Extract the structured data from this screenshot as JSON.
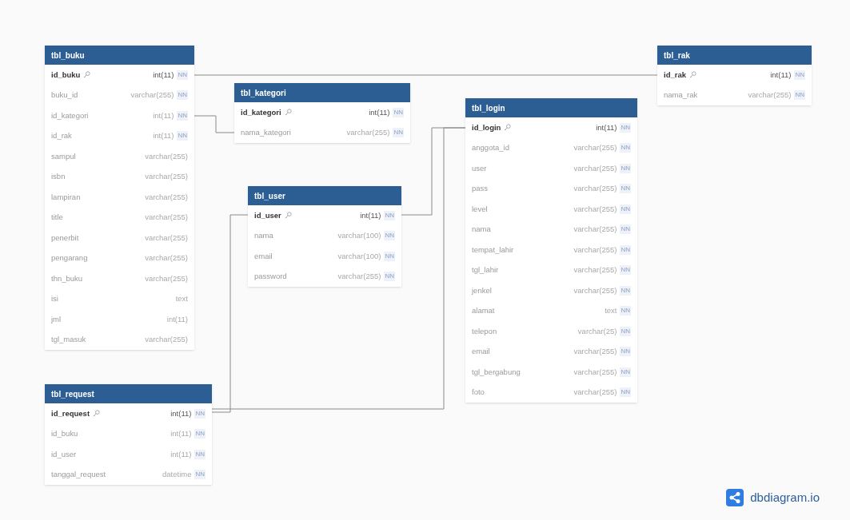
{
  "tables": [
    {
      "name": "tbl_buku",
      "columns": [
        {
          "name": "id_buku",
          "type": "int(11)",
          "constraint": "NN",
          "primary_key": true
        },
        {
          "name": "buku_id",
          "type": "varchar(255)",
          "constraint": "NN",
          "primary_key": false
        },
        {
          "name": "id_kategori",
          "type": "int(11)",
          "constraint": "NN",
          "primary_key": false
        },
        {
          "name": "id_rak",
          "type": "int(11)",
          "constraint": "NN",
          "primary_key": false
        },
        {
          "name": "sampul",
          "type": "varchar(255)",
          "primary_key": false
        },
        {
          "name": "isbn",
          "type": "varchar(255)",
          "primary_key": false
        },
        {
          "name": "lampiran",
          "type": "varchar(255)",
          "primary_key": false
        },
        {
          "name": "title",
          "type": "varchar(255)",
          "primary_key": false
        },
        {
          "name": "penerbit",
          "type": "varchar(255)",
          "primary_key": false
        },
        {
          "name": "pengarang",
          "type": "varchar(255)",
          "primary_key": false
        },
        {
          "name": "thn_buku",
          "type": "varchar(255)",
          "primary_key": false
        },
        {
          "name": "isi",
          "type": "text",
          "primary_key": false
        },
        {
          "name": "jml",
          "type": "int(11)",
          "primary_key": false
        },
        {
          "name": "tgl_masuk",
          "type": "varchar(255)",
          "primary_key": false
        }
      ]
    },
    {
      "name": "tbl_kategori",
      "columns": [
        {
          "name": "id_kategori",
          "type": "int(11)",
          "constraint": "NN",
          "primary_key": true
        },
        {
          "name": "nama_kategori",
          "type": "varchar(255)",
          "constraint": "NN",
          "primary_key": false
        }
      ]
    },
    {
      "name": "tbl_user",
      "columns": [
        {
          "name": "id_user",
          "type": "int(11)",
          "constraint": "NN",
          "primary_key": true
        },
        {
          "name": "nama",
          "type": "varchar(100)",
          "constraint": "NN",
          "primary_key": false
        },
        {
          "name": "email",
          "type": "varchar(100)",
          "constraint": "NN",
          "primary_key": false
        },
        {
          "name": "password",
          "type": "varchar(255)",
          "constraint": "NN",
          "primary_key": false
        }
      ]
    },
    {
      "name": "tbl_login",
      "columns": [
        {
          "name": "id_login",
          "type": "int(11)",
          "constraint": "NN",
          "primary_key": true
        },
        {
          "name": "anggota_id",
          "type": "varchar(255)",
          "constraint": "NN",
          "primary_key": false
        },
        {
          "name": "user",
          "type": "varchar(255)",
          "constraint": "NN",
          "primary_key": false
        },
        {
          "name": "pass",
          "type": "varchar(255)",
          "constraint": "NN",
          "primary_key": false
        },
        {
          "name": "level",
          "type": "varchar(255)",
          "constraint": "NN",
          "primary_key": false
        },
        {
          "name": "nama",
          "type": "varchar(255)",
          "constraint": "NN",
          "primary_key": false
        },
        {
          "name": "tempat_lahir",
          "type": "varchar(255)",
          "constraint": "NN",
          "primary_key": false
        },
        {
          "name": "tgl_lahir",
          "type": "varchar(255)",
          "constraint": "NN",
          "primary_key": false
        },
        {
          "name": "jenkel",
          "type": "varchar(255)",
          "constraint": "NN",
          "primary_key": false
        },
        {
          "name": "alamat",
          "type": "text",
          "constraint": "NN",
          "primary_key": false
        },
        {
          "name": "telepon",
          "type": "varchar(25)",
          "constraint": "NN",
          "primary_key": false
        },
        {
          "name": "email",
          "type": "varchar(255)",
          "constraint": "NN",
          "primary_key": false
        },
        {
          "name": "tgl_bergabung",
          "type": "varchar(255)",
          "constraint": "NN",
          "primary_key": false
        },
        {
          "name": "foto",
          "type": "varchar(255)",
          "constraint": "NN",
          "primary_key": false
        }
      ]
    },
    {
      "name": "tbl_rak",
      "columns": [
        {
          "name": "id_rak",
          "type": "int(11)",
          "constraint": "NN",
          "primary_key": true
        },
        {
          "name": "nama_rak",
          "type": "varchar(255)",
          "constraint": "NN",
          "primary_key": false
        }
      ]
    },
    {
      "name": "tbl_request",
      "columns": [
        {
          "name": "id_request",
          "type": "int(11)",
          "constraint": "NN",
          "primary_key": true
        },
        {
          "name": "id_buku",
          "type": "int(11)",
          "constraint": "NN",
          "primary_key": false
        },
        {
          "name": "id_user",
          "type": "int(11)",
          "constraint": "NN",
          "primary_key": false
        },
        {
          "name": "tanggal_request",
          "type": "datetime",
          "constraint": "NN",
          "primary_key": false
        }
      ]
    }
  ],
  "logo": {
    "text": "dbdiagram.io"
  }
}
